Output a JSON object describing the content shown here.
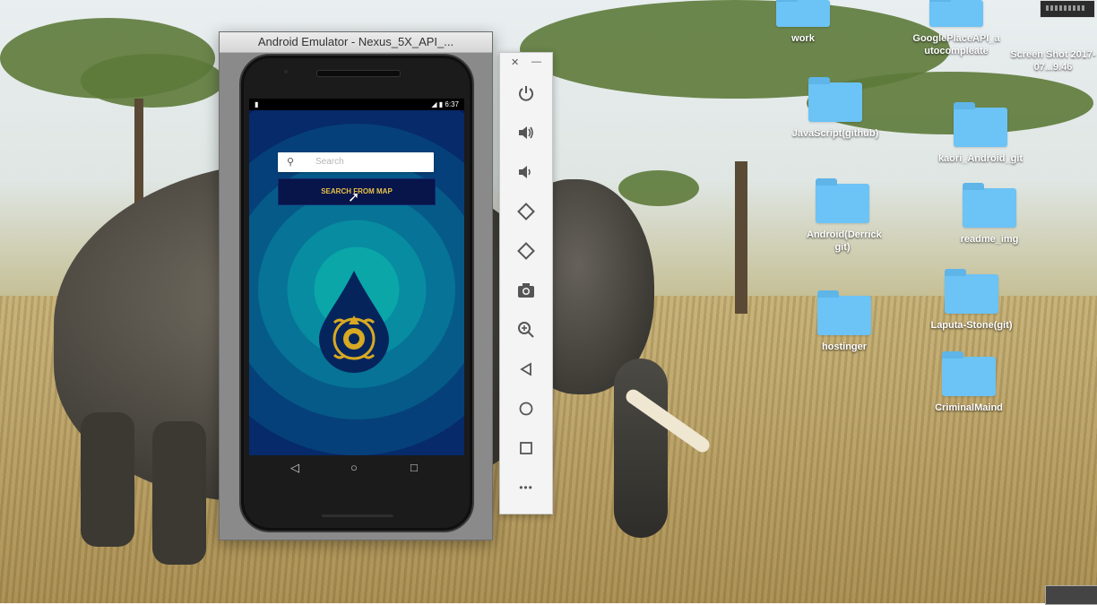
{
  "emulator": {
    "title": "Android Emulator - Nexus_5X_API_...",
    "status_time": "6:37",
    "app": {
      "search_placeholder": "Search",
      "map_button_label": "SEARCH FROM MAP"
    }
  },
  "toolbar": {
    "close": "✕",
    "minimize": "—",
    "buttons": [
      {
        "name": "power",
        "glyph": "⏻"
      },
      {
        "name": "volume-up",
        "glyph": "🔊"
      },
      {
        "name": "volume-down",
        "glyph": "🔉"
      },
      {
        "name": "rotate-left",
        "glyph": "⟲"
      },
      {
        "name": "rotate-right",
        "glyph": "⟳"
      },
      {
        "name": "screenshot",
        "glyph": "📷"
      },
      {
        "name": "zoom",
        "glyph": "🔍"
      },
      {
        "name": "back",
        "glyph": "◁"
      },
      {
        "name": "home",
        "glyph": "○"
      },
      {
        "name": "overview",
        "glyph": "□"
      },
      {
        "name": "more",
        "glyph": "•••"
      }
    ]
  },
  "desktop": {
    "icons": [
      {
        "label": "work"
      },
      {
        "label": "GooglePlaceAPI_a utocompleate"
      },
      {
        "label": "Screen Shot 2017-07...9.46"
      },
      {
        "label": "JavaScript(github)"
      },
      {
        "label": "kaori_Android_git"
      },
      {
        "label": "Android(Derrick git)"
      },
      {
        "label": "readme_img"
      },
      {
        "label": "Laputa-Stone(git)"
      },
      {
        "label": "hostinger"
      },
      {
        "label": "CriminalMaind"
      }
    ]
  },
  "colors": {
    "app_background": "#05114e",
    "ring_teal": "#0aa6a8",
    "button_text": "#e8c24a",
    "folder": "#6cc3f5"
  }
}
